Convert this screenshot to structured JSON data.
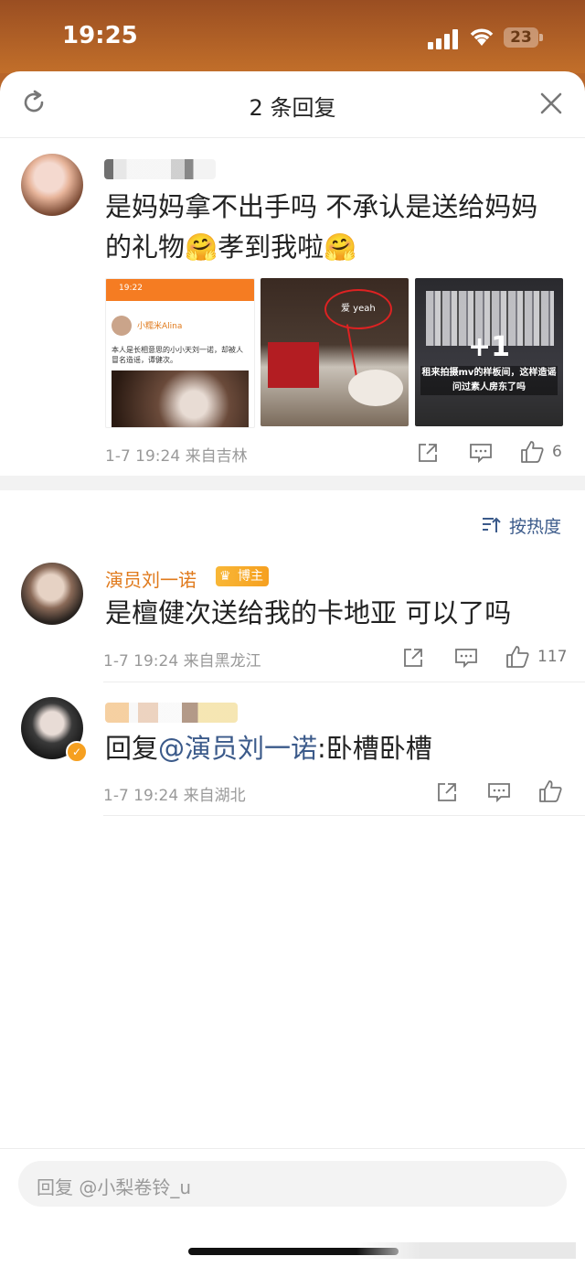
{
  "status_bar": {
    "time": "19:25",
    "battery": "23"
  },
  "header": {
    "title": "2 条回复"
  },
  "root_comment": {
    "text": "是妈妈拿不出手吗 不承认是送给妈妈的礼物🤗孝到我啦🤗",
    "date": "1-7 19:24",
    "location": "来自吉林",
    "likes": "6",
    "images": [
      {
        "phone_time": "19:22",
        "account_name": "小糯米Alina",
        "label": "本人是长相意思的小小天刘一诺，却被人冒名造谣，谭健次。"
      },
      {
        "overlay_text": "爱 yeah"
      },
      {
        "plus": "+1",
        "caption": "租来拍摄mv的样板间，这样造谣问过素人房东了吗"
      }
    ]
  },
  "sort": {
    "label": "按热度"
  },
  "replies": [
    {
      "author": "演员刘一诺",
      "badge": "博主",
      "text": "是檀健次送给我的卡地亚 可以了吗",
      "date": "1-7 19:24",
      "location": "来自黑龙江",
      "likes": "117"
    },
    {
      "prefix": "回复",
      "mention": "@演员刘一诺",
      "body": ":卧槽卧槽",
      "date": "1-7 19:24",
      "location": "来自湖北",
      "likes": ""
    }
  ],
  "input": {
    "placeholder": "回复 @小梨卷铃_u"
  },
  "colors": {
    "accent_orange": "#e07a1c",
    "mention_blue": "#3b5a8a",
    "badge_gold": "#f6a020"
  }
}
